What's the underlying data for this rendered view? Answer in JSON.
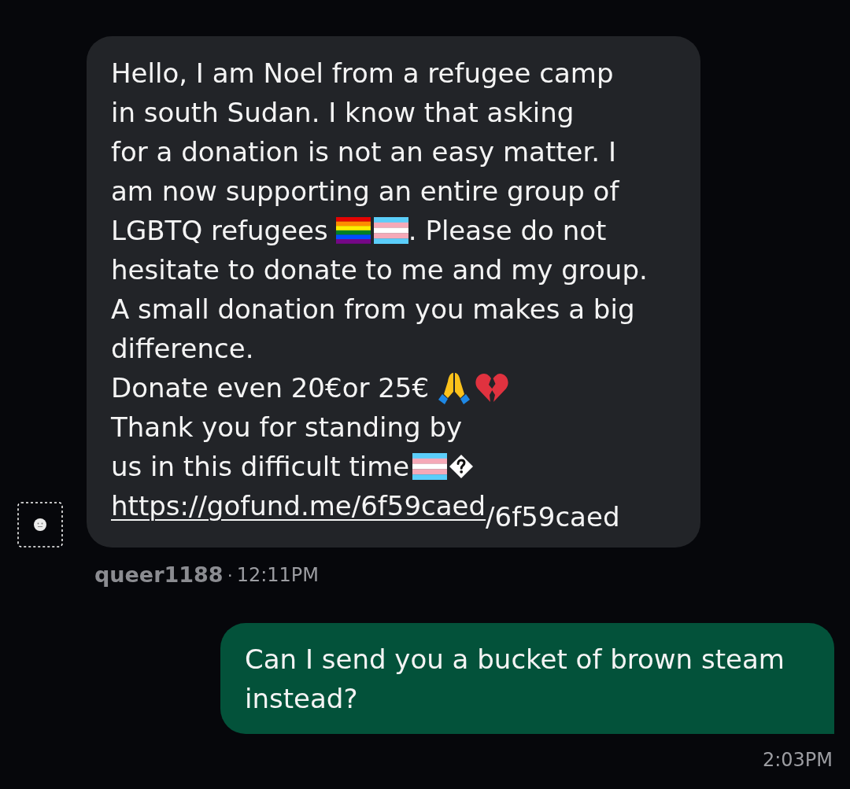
{
  "incoming_message": {
    "lines": [
      [
        {
          "kind": "text",
          "text": "Hello, I am Noel from a refugee camp"
        }
      ],
      [
        {
          "kind": "text",
          "text": "in south Sudan. I know that asking"
        }
      ],
      [
        {
          "kind": "text",
          "text": "for a donation is not an easy matter. I"
        }
      ],
      [
        {
          "kind": "text",
          "text": "am now supporting an entire group of"
        }
      ],
      [
        {
          "kind": "text",
          "text": "LGBTQ refugees"
        },
        {
          "kind": "rainbow_flag"
        },
        {
          "kind": "trans_flag"
        },
        {
          "kind": "text",
          "text": ". Please do not"
        }
      ],
      [
        {
          "kind": "text",
          "text": "hesitate to donate to me and my group."
        }
      ],
      [
        {
          "kind": "text",
          "text": "A small donation from you makes a big"
        }
      ],
      [
        {
          "kind": "text",
          "text": "difference."
        }
      ],
      [
        {
          "kind": "text",
          "text": "Donate even 20€or 25€"
        },
        {
          "kind": "praying_hands"
        },
        {
          "kind": "broken_heart"
        }
      ],
      [
        {
          "kind": "text",
          "text": "Thank you for standing by"
        }
      ],
      [
        {
          "kind": "text",
          "text": "us in this difficult time"
        },
        {
          "kind": "trans_flag"
        },
        {
          "kind": "unknown_glyph"
        }
      ],
      [
        {
          "kind": "link",
          "text": "https://gofund.me/6f59caed"
        },
        {
          "kind": "tail",
          "text": "/6f59caed"
        }
      ]
    ],
    "sender": "queer1188",
    "separator": "·",
    "time": "12:11PM"
  },
  "outgoing_message": {
    "text": "Can I send you a bucket of brown steam instead?",
    "time": "2:03PM"
  }
}
